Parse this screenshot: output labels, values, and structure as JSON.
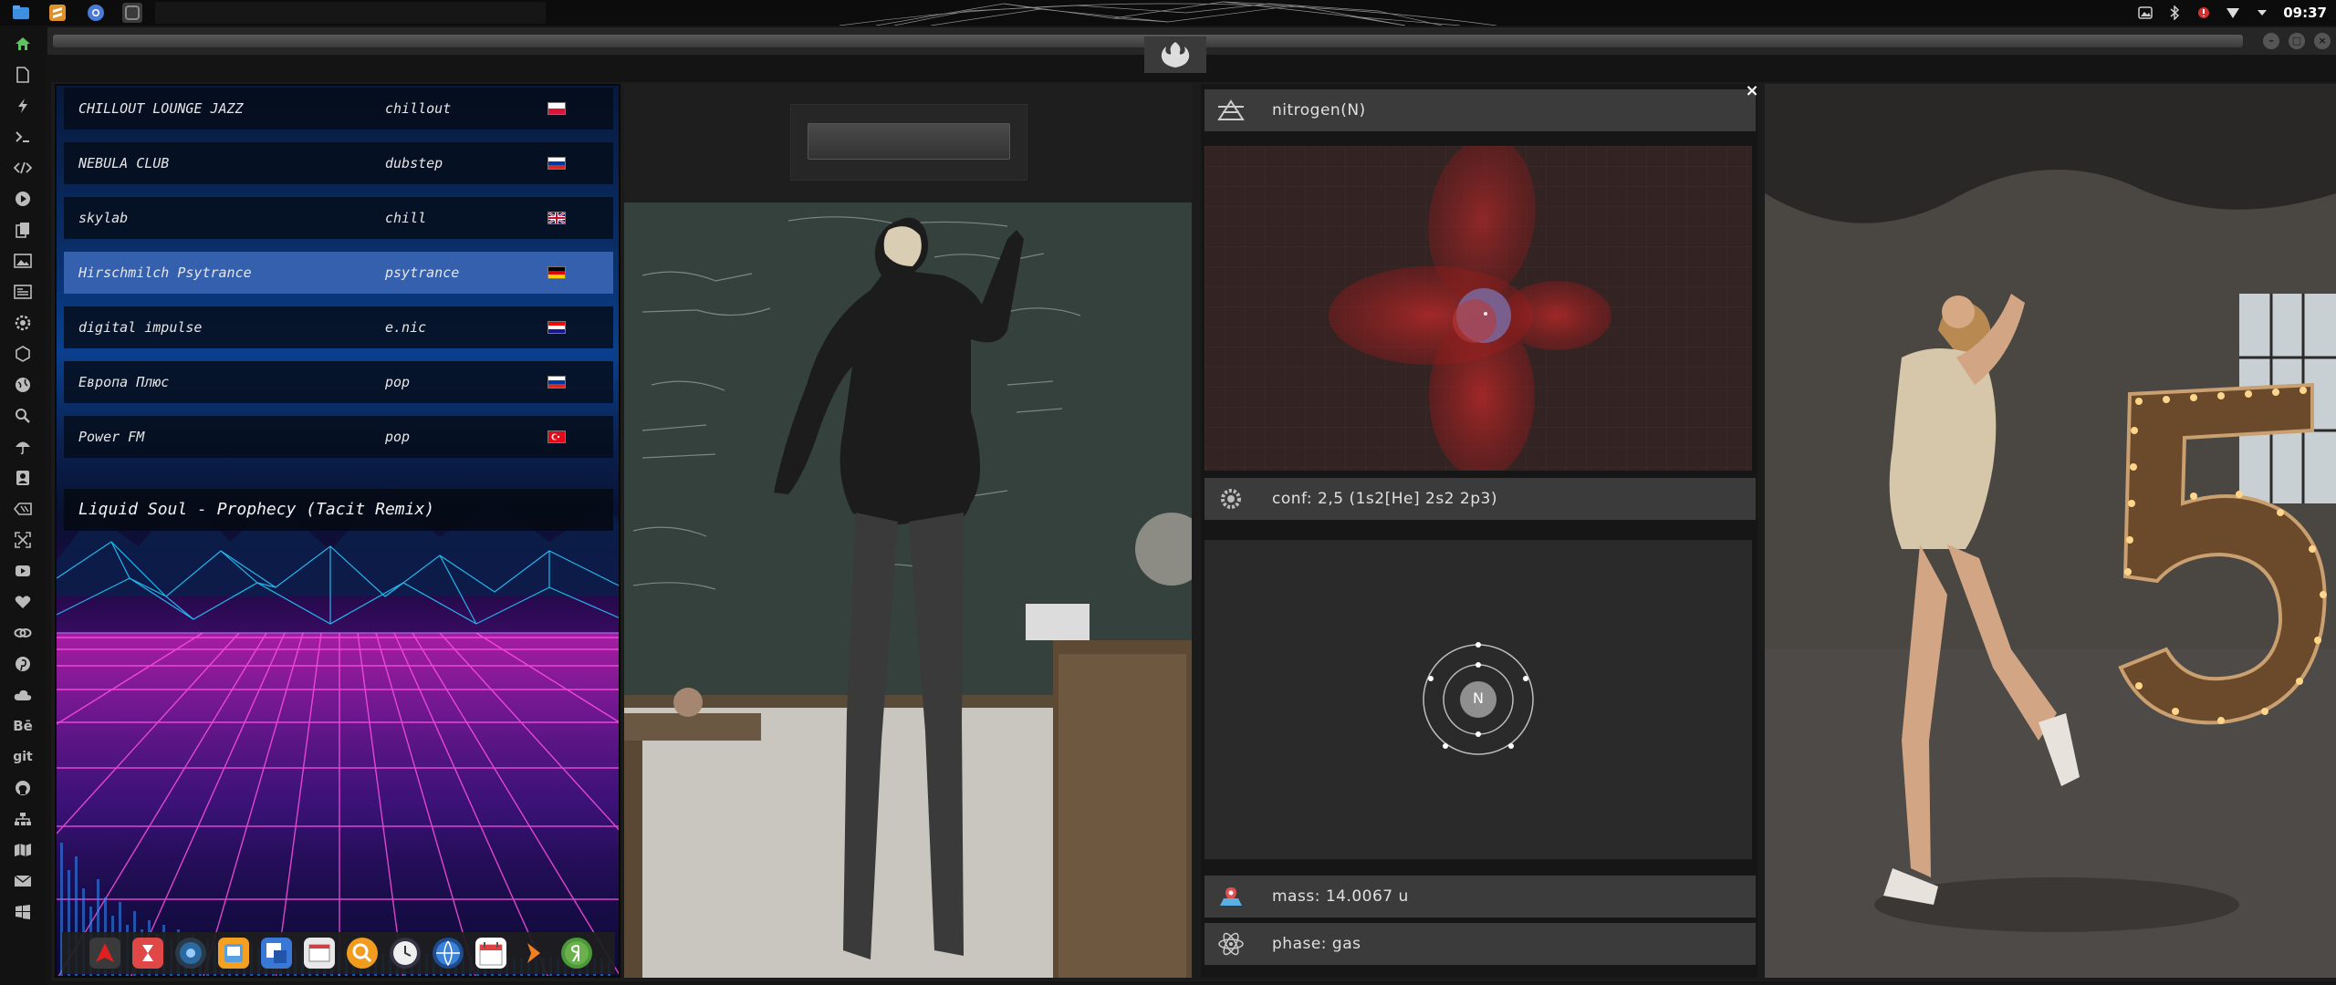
{
  "topbar": {
    "clock": "09:37",
    "apps": [
      {
        "name": "files",
        "color": "#3f8fe0"
      },
      {
        "name": "sublime-text",
        "color": "#f0a030"
      },
      {
        "name": "chromium",
        "color": "#4a7ad8"
      },
      {
        "name": "terminal",
        "color": "#556"
      }
    ]
  },
  "window": {
    "buttons": [
      "–",
      "□",
      "×"
    ]
  },
  "radio": {
    "stations": [
      {
        "name": "CHILLOUT LOUNGE JAZZ",
        "genre": "chillout",
        "flag": "pl"
      },
      {
        "name": "NEBULA CLUB",
        "genre": "dubstep",
        "flag": "ru"
      },
      {
        "name": "skylab",
        "genre": "chill",
        "flag": "gb"
      },
      {
        "name": "Hirschmilch Psytrance",
        "genre": "psytrance",
        "flag": "de"
      },
      {
        "name": "digital impulse",
        "genre": "e.nic",
        "flag": "hr"
      },
      {
        "name": "Европа Плюс",
        "genre": "pop",
        "flag": "ru"
      },
      {
        "name": "Power FM",
        "genre": "pop",
        "flag": "tr"
      }
    ],
    "selected_index": 3,
    "now_playing": "Liquid Soul - Prophecy (Tacit Remix)"
  },
  "element": {
    "name": "nitrogen(N)",
    "configuration": "conf: 2,5 (1s2[He] 2s2 2p3)",
    "symbol": "N",
    "mass": "mass: 14.0067 u",
    "phase": "phase: gas",
    "close": "×"
  },
  "leftdock": {
    "items": [
      "home-icon",
      "document-icon",
      "flash-icon",
      "terminal-icon",
      "code-icon",
      "play-icon",
      "copy-icon",
      "image-icon",
      "newspaper-icon",
      "settings-icon",
      "hexagon-icon",
      "globe-icon",
      "search-icon",
      "umbrella-icon",
      "contact-icon",
      "tag-icon",
      "expand-icon",
      "youtube-icon",
      "heart-icon",
      "link-icon",
      "pinterest-icon",
      "cloud-icon",
      "behance-icon",
      "git-icon",
      "github-icon",
      "sitemap-icon",
      "map-icon",
      "mail-icon",
      "windows-icon"
    ],
    "labels": {
      "behance": "Bē",
      "git": "git"
    }
  },
  "colors": {
    "accent_selected_row": "#3c69b9",
    "panel_bg": "#1b1b1b",
    "orbital_red": "#b02020"
  }
}
